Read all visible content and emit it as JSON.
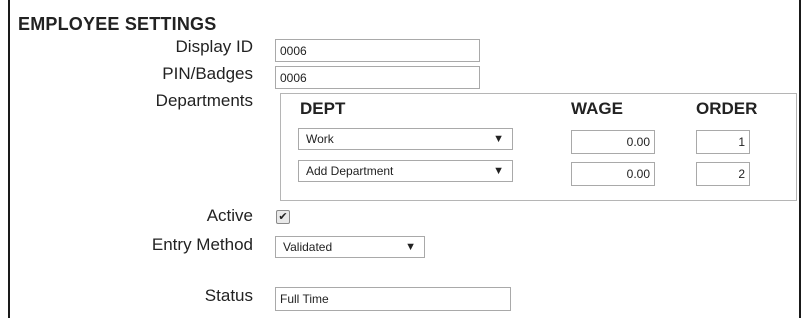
{
  "section_title": "EMPLOYEE SETTINGS",
  "labels": {
    "display_id": "Display ID",
    "pin_badges": "PIN/Badges",
    "departments": "Departments",
    "active": "Active",
    "entry_method": "Entry Method",
    "status": "Status"
  },
  "fields": {
    "display_id": "0006",
    "pin_badges": "0006",
    "status": "Full Time"
  },
  "departments": {
    "headers": {
      "dept": "DEPT",
      "wage": "WAGE",
      "order": "ORDER"
    },
    "rows": [
      {
        "dept": "Work",
        "wage": "0.00",
        "order": "1"
      },
      {
        "dept": "Add Department",
        "wage": "0.00",
        "order": "2"
      }
    ]
  },
  "active": {
    "checked": true,
    "mark": "✔"
  },
  "entry_method": {
    "selected": "Validated"
  },
  "icons": {
    "dropdown_arrow": "▼"
  }
}
